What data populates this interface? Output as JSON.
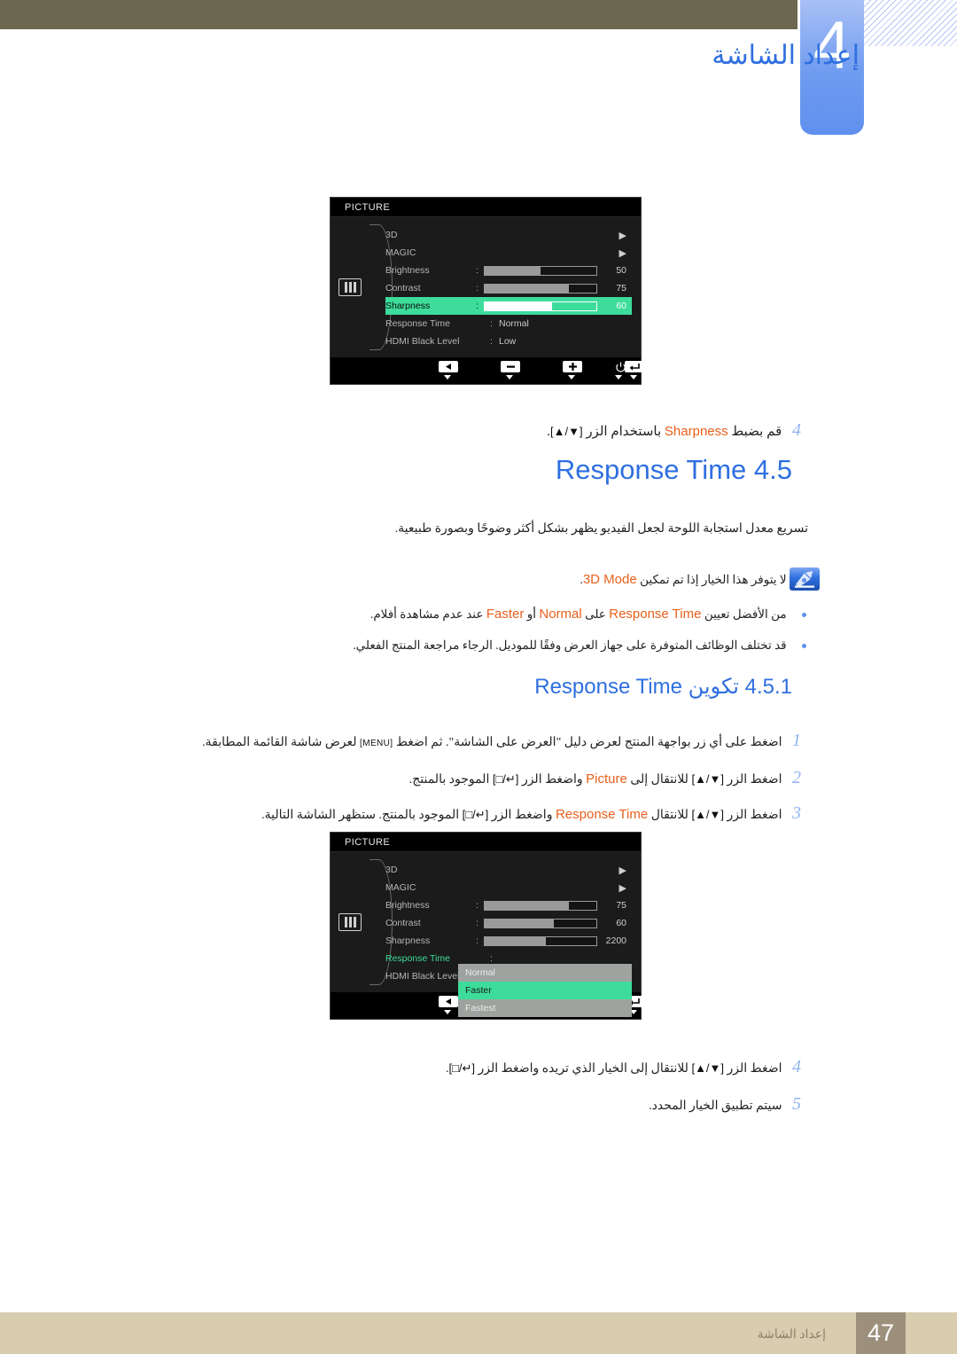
{
  "header": {
    "chapter_number": "4",
    "chapter_title": "إعداد الشاشة"
  },
  "osd_top": {
    "title": "PICTURE",
    "rows": [
      {
        "label": "3D",
        "type": "submenu",
        "arrow": "▶"
      },
      {
        "label": "MAGIC",
        "type": "submenu",
        "arrow": "▶"
      },
      {
        "label": "Brightness",
        "type": "slider",
        "value": "50",
        "percent": 50
      },
      {
        "label": "Contrast",
        "type": "slider",
        "value": "75",
        "percent": 75
      },
      {
        "label": "Sharpness",
        "type": "slider",
        "value": "60",
        "percent": 60,
        "highlighted": true
      },
      {
        "label": "Response Time",
        "type": "text",
        "value": "Normal"
      },
      {
        "label": "HDMI Black Level",
        "type": "text",
        "value": "Low"
      }
    ],
    "buttons": [
      "back-icon",
      "minus-icon",
      "plus-icon",
      "enter-icon",
      "power-icon"
    ]
  },
  "osd_bottom": {
    "title": "PICTURE",
    "rows": [
      {
        "label": "3D",
        "type": "submenu",
        "arrow": "▶"
      },
      {
        "label": "MAGIC",
        "type": "submenu",
        "arrow": "▶"
      },
      {
        "label": "Brightness",
        "type": "slider",
        "value": "75",
        "percent": 75
      },
      {
        "label": "Contrast",
        "type": "slider",
        "value": "60",
        "percent": 60
      },
      {
        "label": "Sharpness",
        "type": "slider",
        "value": "2200",
        "percent": 55
      },
      {
        "label": "Response Time",
        "type": "dropdown-anchor",
        "selected_label": true
      },
      {
        "label": "HDMI Black Level",
        "type": "text",
        "value": ""
      }
    ],
    "dropdown": {
      "options": [
        "Normal",
        "Faster",
        "Fastest"
      ],
      "selected": "Faster"
    },
    "buttons": [
      "back-icon",
      "down-icon",
      "up-icon",
      "enter-icon",
      "power-icon"
    ]
  },
  "step_after_top_osd": {
    "number": "4",
    "text_before": "قم بضبط",
    "highlight": "Sharpness",
    "text_middle": "باستخدام الزر",
    "key": "[▲/▼]",
    "text_after": "."
  },
  "section": {
    "number": "4.5",
    "title_en": "Response Time",
    "description": "تسريع معدل استجابة اللوحة لجعل الفيديو يظهر بشكل أكثر وضوحًا وبصورة طبيعية."
  },
  "notes": [
    {
      "text_before": "لا يتوفر هذا الخيار إذا تم تمكين",
      "highlight": "3D Mode",
      "text_after": "."
    },
    {
      "text_before": "من الأفضل تعيين",
      "highlight": "Response Time",
      "text_middle": "على",
      "highlight2": "Normal",
      "text_middle2": "أو",
      "highlight3": "Faster",
      "text_after": "عند عدم مشاهدة أفلام."
    },
    {
      "text_before": "قد تختلف الوظائف المتوفرة على جهاز العرض وفقًا للموديل. الرجاء مراجعة المنتج الفعلي.",
      "highlight": "",
      "text_after": ""
    }
  ],
  "subsection": {
    "number": "4.5.1",
    "title_ar": "تكوين",
    "title_en": "Response Time"
  },
  "steps": [
    {
      "number": "1",
      "parts": "اضغط على أي زر بواجهة المنتج لعرض دليل \"العرض على الشاشة\". ثم اضغط [MENU] لعرض شاشة القائمة المطابقة."
    },
    {
      "number": "2",
      "parts": "اضغط الزر [▲/▼] للانتقال إلى Picture واضغط الزر [□/↵] الموجود بالمنتج."
    },
    {
      "number": "3",
      "parts": "اضغط الزر [▲/▼] للانتقال Response Time واضغط الزر [□/↵] الموجود بالمنتج. ستظهر الشاشة التالية."
    },
    {
      "number": "4",
      "parts": "اضغط الزر [▲/▼] للانتقال إلى الخيار الذي تريده واضغط الزر [□/↵]."
    },
    {
      "number": "5",
      "parts": "سيتم تطبيق الخيار المحدد."
    }
  ],
  "step_fragments": {
    "s1_a": "اضغط على أي زر بواجهة المنتج لعرض دليل \"العرض على الشاشة\". ثم اضغط",
    "s1_key": "[MENU]",
    "s1_b": "لعرض شاشة القائمة المطابقة.",
    "s2_a": "اضغط الزر",
    "s2_key1": "[▲/▼]",
    "s2_b": "للانتقال إلى",
    "s2_hl": "Picture",
    "s2_c": "واضغط الزر",
    "s2_key2": "[□/↵]",
    "s2_d": "الموجود بالمنتج.",
    "s3_a": "اضغط الزر",
    "s3_key1": "[▲/▼]",
    "s3_b": "للانتقال",
    "s3_hl": "Response Time",
    "s3_c": "واضغط الزر",
    "s3_key2": "[□/↵]",
    "s3_d": "الموجود بالمنتج. ستظهر الشاشة التالية.",
    "s4_a": "اضغط الزر",
    "s4_key1": "[▲/▼]",
    "s4_b": "للانتقال إلى الخيار الذي تريده واضغط الزر",
    "s4_key2": "[□/↵]",
    "s4_c": ".",
    "s5_a": "سيتم تطبيق الخيار المحدد."
  },
  "footer": {
    "text": "إعداد الشاشة",
    "page": "47"
  },
  "colors": {
    "accent_blue": "#2f6fe0",
    "highlight_orange": "#e8601c",
    "osd_green": "#3ddc9b",
    "header_bar": "#6b6751",
    "footer_bar": "#d9cdb0",
    "page_box": "#9c907c"
  }
}
